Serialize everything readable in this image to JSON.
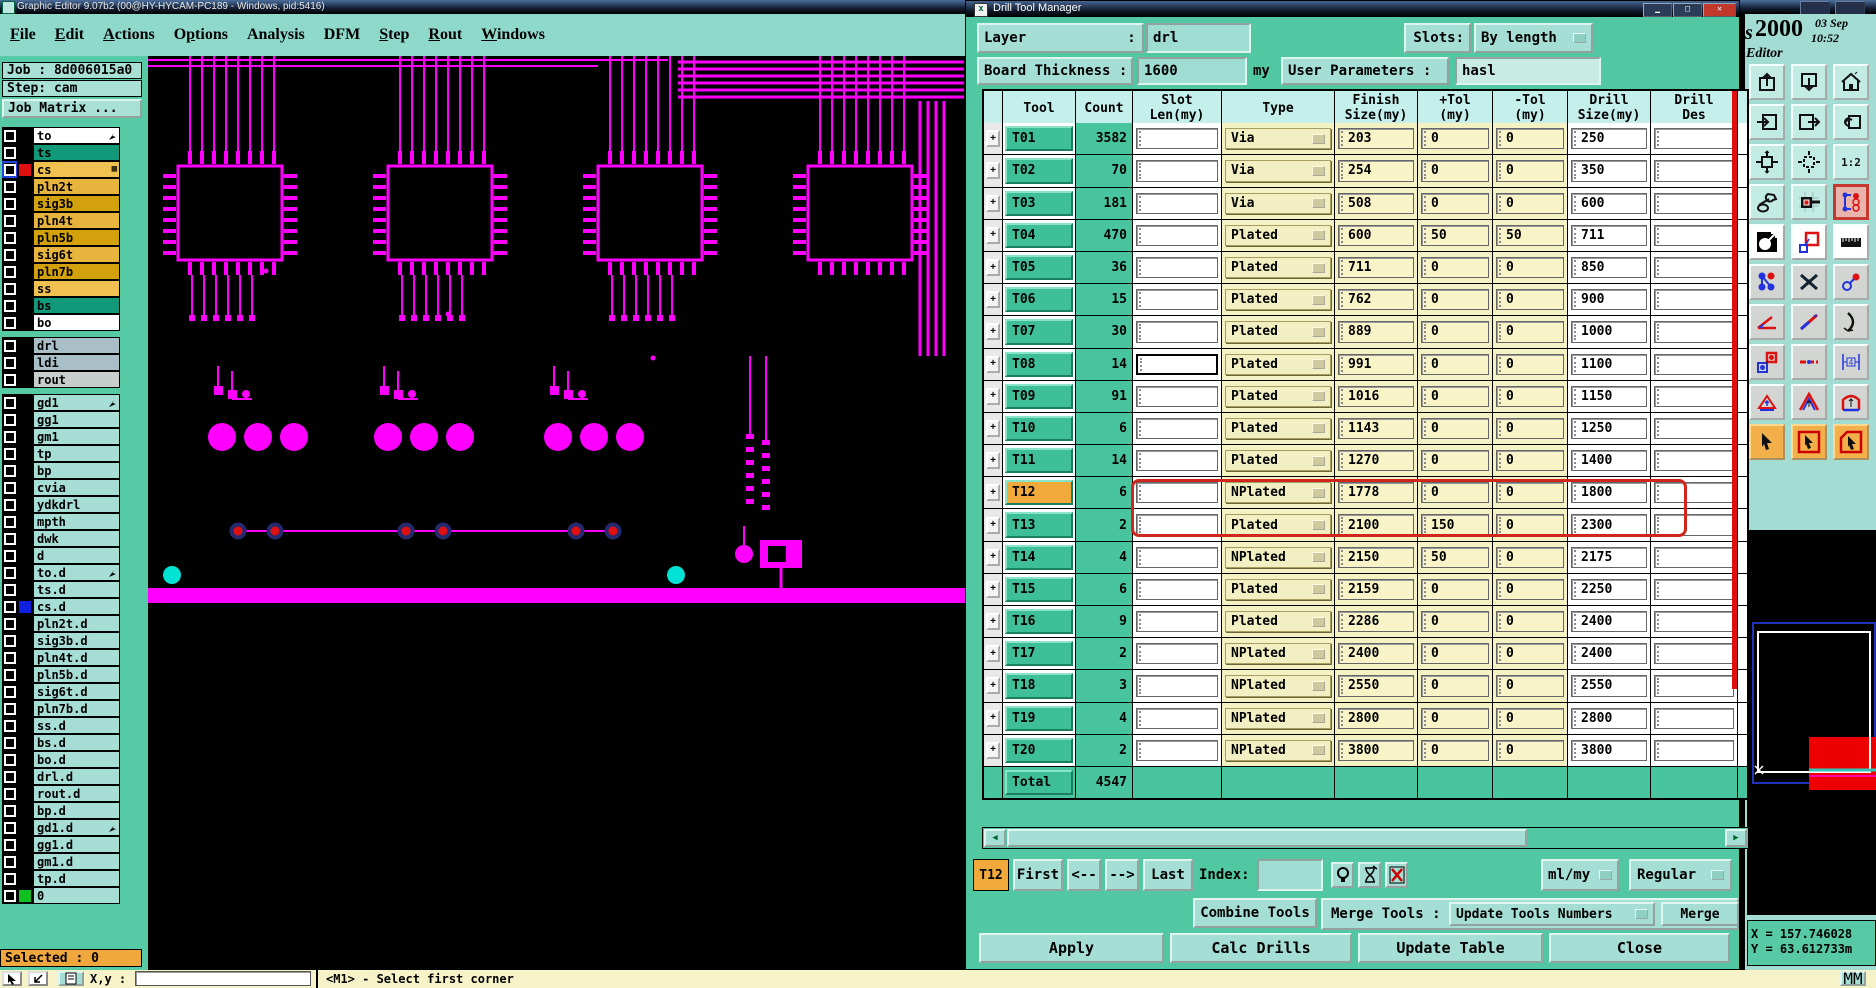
{
  "window": {
    "title": "Graphic Editor 9.07b2 (00@HY-HYCAM-PC189 - Windows, pid:5416)",
    "menu": [
      {
        "label": "File",
        "underline": 0
      },
      {
        "label": "Edit",
        "underline": 0
      },
      {
        "label": "Actions",
        "underline": 0
      },
      {
        "label": "Options",
        "underline": 1
      },
      {
        "label": "Analysis",
        "underline": -1
      },
      {
        "label": "DFM",
        "underline": -1
      },
      {
        "label": "Step",
        "underline": 0
      },
      {
        "label": "Rout",
        "underline": 0
      },
      {
        "label": "Windows",
        "underline": 0
      }
    ]
  },
  "sidebar": {
    "job": "Job : 8d006015a0",
    "step": "Step: cam",
    "job_matrix": "Job Matrix ...",
    "selected": "Selected : 0",
    "layers": [
      {
        "name": "to",
        "style": "white",
        "arrow": true
      },
      {
        "name": "ts",
        "style": "green"
      },
      {
        "name": "cs",
        "style": "gold",
        "marker": "red",
        "chk": "blue",
        "grid": true
      },
      {
        "name": "pln2t",
        "style": "gold2"
      },
      {
        "name": "sig3b",
        "style": "gold3"
      },
      {
        "name": "pln4t",
        "style": "gold2"
      },
      {
        "name": "pln5b",
        "style": "gold3"
      },
      {
        "name": "sig6t",
        "style": "gold2"
      },
      {
        "name": "pln7b",
        "style": "gold3"
      },
      {
        "name": "ss",
        "style": "gold"
      },
      {
        "name": "bs",
        "style": "green"
      },
      {
        "name": "bo",
        "style": "white"
      },
      {
        "sep": true
      },
      {
        "name": "drl",
        "style": "bluegray"
      },
      {
        "name": "ldi",
        "style": "bluegray"
      },
      {
        "name": "rout",
        "style": "gray"
      },
      {
        "sep": true
      },
      {
        "name": "gd1",
        "style": "teal",
        "arrow": true
      },
      {
        "name": "gg1",
        "style": "teal"
      },
      {
        "name": "gm1",
        "style": "teal"
      },
      {
        "name": "tp",
        "style": "teal"
      },
      {
        "name": "bp",
        "style": "teal"
      },
      {
        "name": "cvia",
        "style": "teal"
      },
      {
        "name": "ydkdrl",
        "style": "teal"
      },
      {
        "name": "mpth",
        "style": "teal"
      },
      {
        "name": "dwk",
        "style": "teal"
      },
      {
        "name": "d",
        "style": "teal"
      },
      {
        "name": "to.d",
        "style": "teal",
        "arrow": true
      },
      {
        "name": "ts.d",
        "style": "teal"
      },
      {
        "name": "cs.d",
        "style": "teal",
        "marker": "blue"
      },
      {
        "name": "pln2t.d",
        "style": "teal"
      },
      {
        "name": "sig3b.d",
        "style": "teal"
      },
      {
        "name": "pln4t.d",
        "style": "teal"
      },
      {
        "name": "pln5b.d",
        "style": "teal"
      },
      {
        "name": "sig6t.d",
        "style": "teal"
      },
      {
        "name": "pln7b.d",
        "style": "teal"
      },
      {
        "name": "ss.d",
        "style": "teal"
      },
      {
        "name": "bs.d",
        "style": "teal"
      },
      {
        "name": "bo.d",
        "style": "teal"
      },
      {
        "name": "drl.d",
        "style": "teal"
      },
      {
        "name": "rout.d",
        "style": "teal"
      },
      {
        "name": "bp.d",
        "style": "teal"
      },
      {
        "name": "gd1.d",
        "style": "teal",
        "arrow": true
      },
      {
        "name": "gg1.d",
        "style": "teal"
      },
      {
        "name": "gm1.d",
        "style": "teal"
      },
      {
        "name": "tp.d",
        "style": "teal"
      },
      {
        "name": "0",
        "style": "teal",
        "marker": "green"
      }
    ]
  },
  "dialog": {
    "title": "Drill Tool Manager",
    "layer_label": "Layer            :",
    "layer_value": "drl",
    "slots_label": "Slots:",
    "slots_value": "By length",
    "board_label": "Board Thickness :",
    "board_value": "1600",
    "board_unit": "my",
    "user_label": "User Parameters :",
    "user_value": "hasl",
    "table": {
      "headers": [
        "Tool",
        "Count",
        "Slot\nLen(my)",
        "Type",
        "Finish\nSize(my)",
        "+Tol\n(my)",
        "-Tol\n(my)",
        "Drill\nSize(my)",
        "Drill\nDes"
      ],
      "rows": [
        {
          "tool": "T01",
          "count": "3582",
          "slot_len": "",
          "type": "Via",
          "finish": "203",
          "ptol": "0",
          "ntol": "0",
          "drill": "250",
          "des": ""
        },
        {
          "tool": "T02",
          "count": "70",
          "slot_len": "",
          "type": "Via",
          "finish": "254",
          "ptol": "0",
          "ntol": "0",
          "drill": "350",
          "des": ""
        },
        {
          "tool": "T03",
          "count": "181",
          "slot_len": "",
          "type": "Via",
          "finish": "508",
          "ptol": "0",
          "ntol": "0",
          "drill": "600",
          "des": ""
        },
        {
          "tool": "T04",
          "count": "470",
          "slot_len": "",
          "type": "Plated",
          "finish": "600",
          "ptol": "50",
          "ntol": "50",
          "drill": "711",
          "des": ""
        },
        {
          "tool": "T05",
          "count": "36",
          "slot_len": "",
          "type": "Plated",
          "finish": "711",
          "ptol": "0",
          "ntol": "0",
          "drill": "850",
          "des": ""
        },
        {
          "tool": "T06",
          "count": "15",
          "slot_len": "",
          "type": "Plated",
          "finish": "762",
          "ptol": "0",
          "ntol": "0",
          "drill": "900",
          "des": ""
        },
        {
          "tool": "T07",
          "count": "30",
          "slot_len": "",
          "type": "Plated",
          "finish": "889",
          "ptol": "0",
          "ntol": "0",
          "drill": "1000",
          "des": ""
        },
        {
          "tool": "T08",
          "count": "14",
          "slot_len": "",
          "type": "Plated",
          "finish": "991",
          "ptol": "0",
          "ntol": "0",
          "drill": "1100",
          "des": "",
          "slot_focused": true
        },
        {
          "tool": "T09",
          "count": "91",
          "slot_len": "",
          "type": "Plated",
          "finish": "1016",
          "ptol": "0",
          "ntol": "0",
          "drill": "1150",
          "des": ""
        },
        {
          "tool": "T10",
          "count": "6",
          "slot_len": "",
          "type": "Plated",
          "finish": "1143",
          "ptol": "0",
          "ntol": "0",
          "drill": "1250",
          "des": ""
        },
        {
          "tool": "T11",
          "count": "14",
          "slot_len": "",
          "type": "Plated",
          "finish": "1270",
          "ptol": "0",
          "ntol": "0",
          "drill": "1400",
          "des": ""
        },
        {
          "tool": "T12",
          "count": "6",
          "slot_len": "",
          "type": "NPlated",
          "finish": "1778",
          "ptol": "0",
          "ntol": "0",
          "drill": "1800",
          "des": "",
          "selected": true
        },
        {
          "tool": "T13",
          "count": "2",
          "slot_len": "",
          "type": "Plated",
          "finish": "2100",
          "ptol": "150",
          "ntol": "0",
          "drill": "2300",
          "des": ""
        },
        {
          "tool": "T14",
          "count": "4",
          "slot_len": "",
          "type": "NPlated",
          "finish": "2150",
          "ptol": "50",
          "ntol": "0",
          "drill": "2175",
          "des": ""
        },
        {
          "tool": "T15",
          "count": "6",
          "slot_len": "",
          "type": "Plated",
          "finish": "2159",
          "ptol": "0",
          "ntol": "0",
          "drill": "2250",
          "des": ""
        },
        {
          "tool": "T16",
          "count": "9",
          "slot_len": "",
          "type": "Plated",
          "finish": "2286",
          "ptol": "0",
          "ntol": "0",
          "drill": "2400",
          "des": ""
        },
        {
          "tool": "T17",
          "count": "2",
          "slot_len": "",
          "type": "NPlated",
          "finish": "2400",
          "ptol": "0",
          "ntol": "0",
          "drill": "2400",
          "des": ""
        },
        {
          "tool": "T18",
          "count": "3",
          "slot_len": "",
          "type": "NPlated",
          "finish": "2550",
          "ptol": "0",
          "ntol": "0",
          "drill": "2550",
          "des": ""
        },
        {
          "tool": "T19",
          "count": "4",
          "slot_len": "",
          "type": "NPlated",
          "finish": "2800",
          "ptol": "0",
          "ntol": "0",
          "drill": "2800",
          "des": ""
        },
        {
          "tool": "T20",
          "count": "2",
          "slot_len": "",
          "type": "NPlated",
          "finish": "3800",
          "ptol": "0",
          "ntol": "0",
          "drill": "3800",
          "des": ""
        }
      ],
      "total_label": "Total",
      "total_count": "4547"
    },
    "nav": {
      "tool": "T12",
      "first": "First",
      "prev": "<--",
      "next": "-->",
      "last": "Last",
      "index_label": "Index:",
      "index_value": "",
      "units": "ml/my",
      "mode": "Regular"
    },
    "actions": {
      "combine": "Combine Tools",
      "merge_label": "Merge Tools :",
      "merge_mode": "Update Tools Numbers",
      "merge": "Merge",
      "apply": "Apply",
      "calc": "Calc Drills",
      "update": "Update Table",
      "close": "Close"
    }
  },
  "right_panel": {
    "brand_prefix": "s",
    "brand": "2000",
    "date_line": "03 Sep",
    "time": "10:52",
    "app": "Editor",
    "coord_x": "X = 157.746028",
    "coord_y": "Y = 63.612733m",
    "toolbar": [
      {
        "name": "paste-up-icon",
        "style": "teal"
      },
      {
        "name": "paste-down-icon",
        "style": "teal"
      },
      {
        "name": "home-icon",
        "style": "teal"
      },
      {
        "name": "pan-left-icon",
        "style": "teal"
      },
      {
        "name": "pan-right-icon",
        "style": "teal"
      },
      {
        "name": "undo-view-icon",
        "style": "teal"
      },
      {
        "name": "zoom-fit-icon",
        "style": "teal"
      },
      {
        "name": "zoom-center-icon",
        "style": "teal"
      },
      {
        "name": "zoom-1-2-icon",
        "style": "teal"
      },
      {
        "name": "setup-tools-icon",
        "style": "teal"
      },
      {
        "name": "target-origin-icon",
        "style": "teal"
      },
      {
        "name": "layer-signals-icon",
        "style": "active"
      },
      {
        "name": "invert-view-icon",
        "style": "white"
      },
      {
        "name": "shape-edit-icon",
        "style": "white"
      },
      {
        "name": "ruler-icon",
        "style": "white"
      },
      {
        "name": "net-nodes-icon",
        "style": "grey"
      },
      {
        "name": "delete-x-icon",
        "style": "grey"
      },
      {
        "name": "measure-point-icon",
        "style": "grey"
      },
      {
        "name": "angle-icon",
        "style": "grey"
      },
      {
        "name": "slope-line-icon",
        "style": "grey"
      },
      {
        "name": "arc-icon",
        "style": "grey"
      },
      {
        "name": "pad-copy-icon",
        "style": "grey"
      },
      {
        "name": "trace-icon",
        "style": "grey"
      },
      {
        "name": "gauge-icon",
        "style": "grey"
      },
      {
        "name": "triangle-marker-icon",
        "style": "grey"
      },
      {
        "name": "peak-marker-icon",
        "style": "grey"
      },
      {
        "name": "gate-marker-icon",
        "style": "grey"
      },
      {
        "name": "select-arrow-icon",
        "style": "orange"
      },
      {
        "name": "select-frame-icon",
        "style": "orange"
      },
      {
        "name": "select-region-icon",
        "style": "orange"
      }
    ]
  },
  "status_bar": {
    "xy_label": "X,y :",
    "xy_value": "",
    "hint": "<M1> - Select first corner",
    "mm_button": "MM"
  },
  "colors": {
    "trace_magenta": "#ff00ff",
    "via_red": "#e01010",
    "pad_cyan": "#00e2d4",
    "panel_teal": "#52c8a2",
    "accent_orange": "#f2a93b",
    "annotation_red": "#d0261c"
  }
}
